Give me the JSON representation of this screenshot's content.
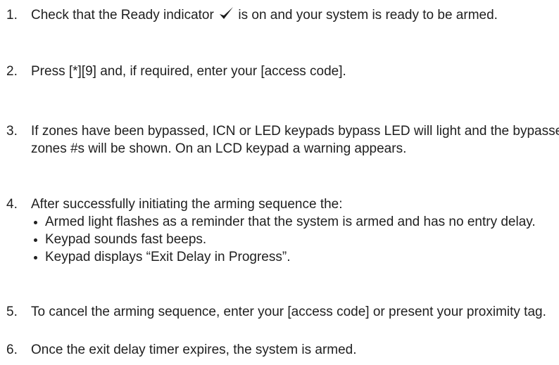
{
  "steps": [
    {
      "num": "1.",
      "text_before": "Check that the Ready indicator ",
      "icon": "checkmark-icon",
      "text_after": " is on and your system is ready to be armed."
    },
    {
      "num": "2.",
      "text": "Press [*][9] and, if required, enter your [access code]."
    },
    {
      "num": "3.",
      "text": "If zones have been bypassed, ICN or LED keypads bypass LED will light and the bypassed zones #s will be shown. On an LCD keypad a warning appears."
    },
    {
      "num": "4.",
      "text": "After successfully initiating the arming sequence the:",
      "bullets": [
        "Armed light flashes as a reminder that the system is armed and has no entry delay.",
        "Keypad sounds fast beeps.",
        "Keypad displays “Exit Delay in Progress”."
      ]
    },
    {
      "num": "5.",
      "text": "To cancel the arming sequence, enter your [access code] or present your proximity tag."
    },
    {
      "num": "6.",
      "text": "Once the exit delay timer expires, the system is armed."
    }
  ]
}
